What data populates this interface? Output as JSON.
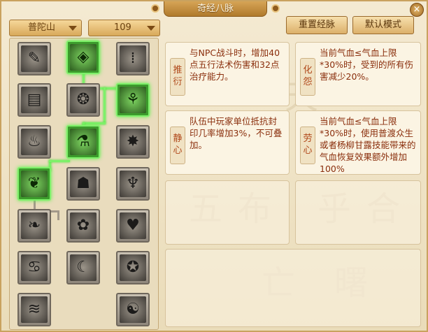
{
  "window": {
    "title": "奇经八脉",
    "close_label": "×"
  },
  "header": {
    "faction_select": "普陀山",
    "level_select": "109",
    "reset_button": "重置经脉",
    "default_button": "默认模式"
  },
  "watermark": [
    "天",
    "五",
    "布",
    "乎",
    "合",
    "亡",
    "曙"
  ],
  "tree": {
    "nodes": [
      {
        "id": "n1",
        "icon": "feather-icon",
        "glyph": "✎",
        "active": false
      },
      {
        "id": "n2",
        "icon": "jade-charm-icon",
        "glyph": "◈",
        "active": true
      },
      {
        "id": "n3",
        "icon": "rain-icon",
        "glyph": "⁞",
        "active": false
      },
      {
        "id": "n4",
        "icon": "scroll-icon",
        "glyph": "▤",
        "active": false
      },
      {
        "id": "n5",
        "icon": "dharma-wheel-icon",
        "glyph": "❂",
        "active": false
      },
      {
        "id": "n6",
        "icon": "willow-icon",
        "glyph": "⚘",
        "active": true
      },
      {
        "id": "n7",
        "icon": "lotus-flame-icon",
        "glyph": "♨",
        "active": false
      },
      {
        "id": "n8",
        "icon": "incense-icon",
        "glyph": "⚗",
        "active": true
      },
      {
        "id": "n9",
        "icon": "burst-icon",
        "glyph": "✸",
        "active": false
      },
      {
        "id": "n10",
        "icon": "bodhi-tree-icon",
        "glyph": "❦",
        "active": true
      },
      {
        "id": "n11",
        "icon": "pagoda-icon",
        "glyph": "☗",
        "active": false
      },
      {
        "id": "n12",
        "icon": "chalice-icon",
        "glyph": "♆",
        "active": false
      },
      {
        "id": "n13",
        "icon": "leaf-drop-icon",
        "glyph": "❧",
        "active": false
      },
      {
        "id": "n14",
        "icon": "cloud-flower-icon",
        "glyph": "✿",
        "active": false
      },
      {
        "id": "n15",
        "icon": "heart-icon",
        "glyph": "♥",
        "active": false
      },
      {
        "id": "n16",
        "icon": "dancer-icon",
        "glyph": "♋",
        "active": false
      },
      {
        "id": "n17",
        "icon": "moon-icon",
        "glyph": "☾",
        "active": false
      },
      {
        "id": "n18",
        "icon": "pentagram-icon",
        "glyph": "✪",
        "active": false
      },
      {
        "id": "n19",
        "icon": "wave-icon",
        "glyph": "≋",
        "active": false
      },
      {
        "id": "n20",
        "icon": "bagua-icon",
        "glyph": "☯",
        "active": false
      }
    ]
  },
  "cards": [
    {
      "tag": "推衍",
      "text": "与NPC战斗时，增加40点五行法术伤害和32点治疗能力。"
    },
    {
      "tag": "化怨",
      "text": "当前气血≤气血上限*30%时，受到的所有伤害减少20%。"
    },
    {
      "tag": "静心",
      "text": "队伍中玩家单位抵抗封印几率增加3%，不可叠加。"
    },
    {
      "tag": "劳心",
      "text": "当前气血≤气血上限*30%时，使用普渡众生或者杨柳甘露技能带来的气血恢复效果额外增加100%"
    }
  ]
}
